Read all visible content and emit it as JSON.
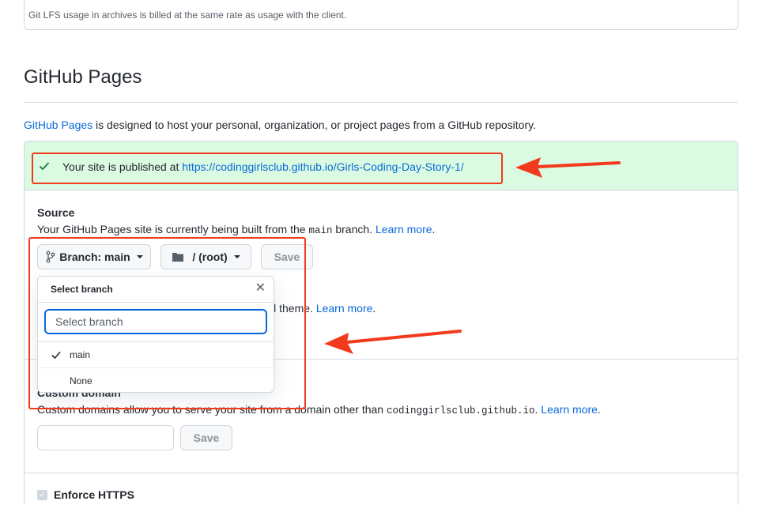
{
  "lfs_note": "Git LFS usage in archives is billed at the same rate as usage with the client.",
  "section_title": "GitHub Pages",
  "intro": {
    "link": "GitHub Pages",
    "text": " is designed to host your personal, organization, or project pages from a GitHub repository."
  },
  "published": {
    "text": "Your site is published at ",
    "url": "https://codinggirlsclub.github.io/Girls-Coding-Day-Story-1/"
  },
  "source": {
    "label": "Source",
    "desc_prefix": "Your GitHub Pages site is currently being built from the ",
    "branch_code": "main",
    "desc_suffix": " branch. ",
    "learn_more": "Learn more",
    "period": "."
  },
  "buttons": {
    "branch": "Branch: main",
    "root": "/ (root)",
    "save": "Save"
  },
  "theme": {
    "text": "ll theme. ",
    "learn_more": "Learn more",
    "period": "."
  },
  "dropdown": {
    "title": "Select branch",
    "filter_placeholder": "Select branch",
    "items": [
      "main",
      "None"
    ]
  },
  "custom_domain": {
    "label": "Custom domain",
    "desc_prefix": "Custom domains allow you to serve your site from a domain other than ",
    "domain_code": "codinggirlsclub.github.io",
    "desc_suffix": ". ",
    "learn_more": "Learn more",
    "period": ".",
    "save": "Save"
  },
  "https": {
    "label": "Enforce HTTPS"
  },
  "colors": {
    "link": "#0969da",
    "success_bg": "#dafbe1",
    "annotation": "#f23a1d"
  }
}
